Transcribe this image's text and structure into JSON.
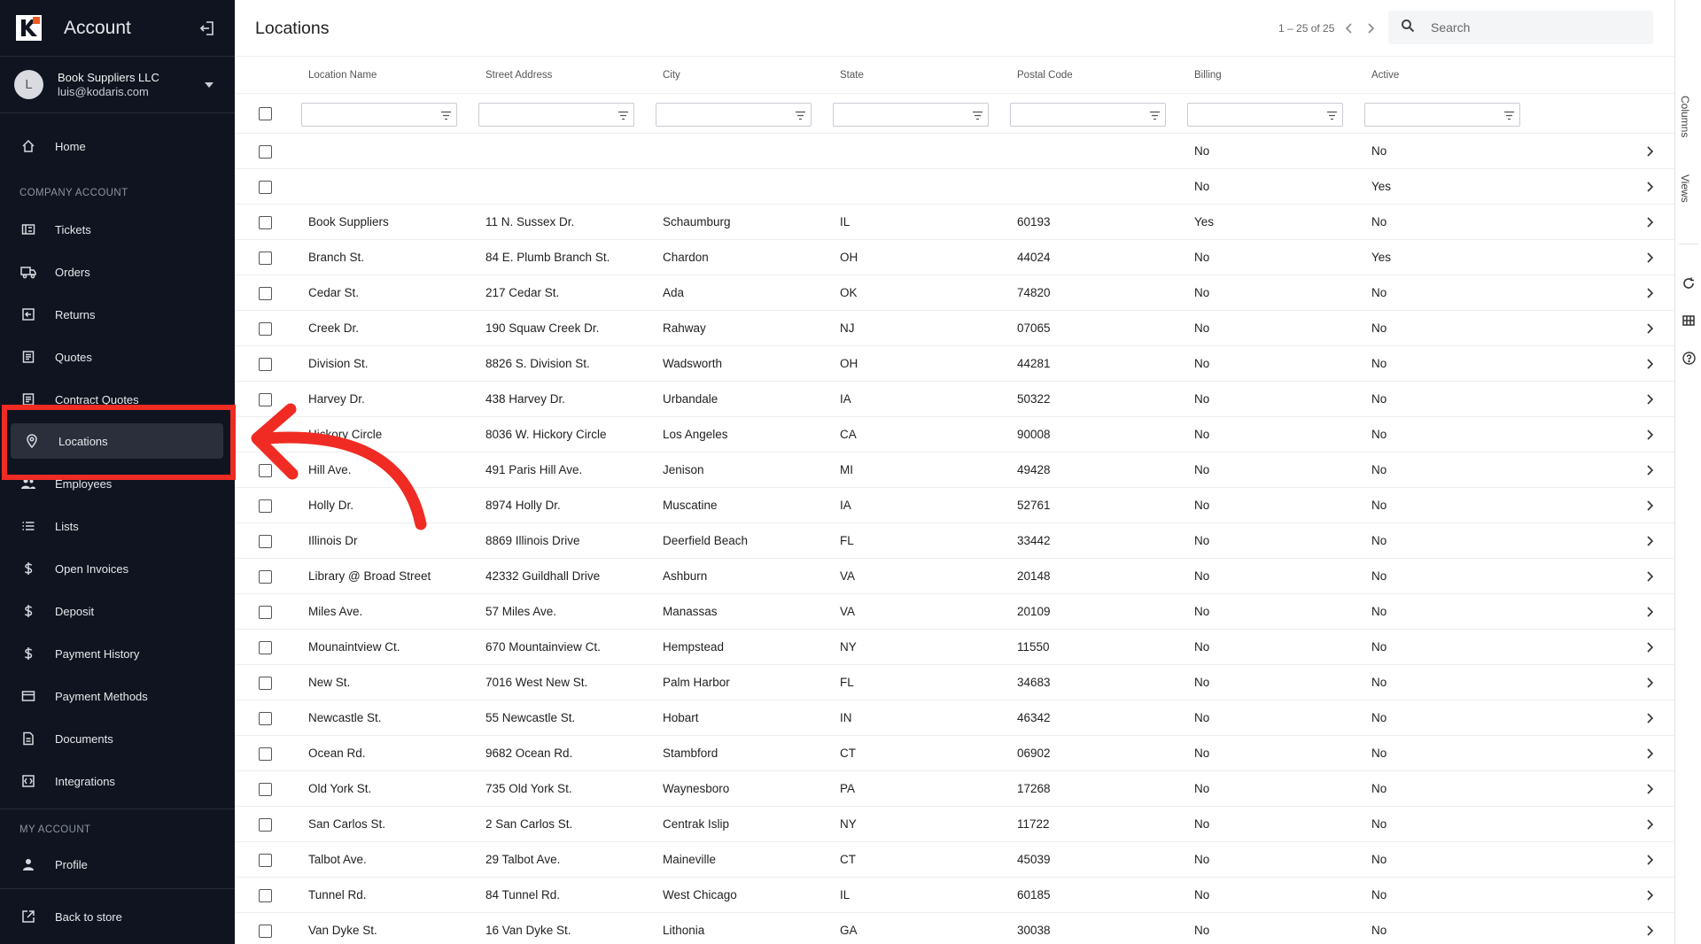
{
  "sidebar": {
    "title": "Account",
    "account": {
      "avatar_letter": "L",
      "company": "Book Suppliers LLC",
      "email": "luis@kodaris.com"
    },
    "home_label": "Home",
    "company_section": "COMPANY ACCOUNT",
    "company_items": [
      {
        "label": "Tickets",
        "icon": "ticket-icon"
      },
      {
        "label": "Orders",
        "icon": "truck-icon"
      },
      {
        "label": "Returns",
        "icon": "return-icon"
      },
      {
        "label": "Quotes",
        "icon": "document-icon"
      },
      {
        "label": "Contract Quotes",
        "icon": "document-icon"
      },
      {
        "label": "Locations",
        "icon": "location-pin-icon",
        "active": true
      },
      {
        "label": "Employees",
        "icon": "people-icon"
      },
      {
        "label": "Lists",
        "icon": "list-icon"
      },
      {
        "label": "Open Invoices",
        "icon": "dollar-icon"
      },
      {
        "label": "Deposit",
        "icon": "dollar-icon"
      },
      {
        "label": "Payment History",
        "icon": "dollar-icon"
      },
      {
        "label": "Payment Methods",
        "icon": "credit-card-icon"
      },
      {
        "label": "Documents",
        "icon": "file-icon"
      },
      {
        "label": "Integrations",
        "icon": "integration-icon"
      }
    ],
    "my_section": "MY ACCOUNT",
    "profile_label": "Profile",
    "back_label": "Back to store"
  },
  "main": {
    "title": "Locations",
    "pagination": "1 – 25 of 25",
    "search_placeholder": "Search",
    "columns": [
      "Location Name",
      "Street Address",
      "City",
      "State",
      "Postal Code",
      "Billing",
      "Active"
    ],
    "rows": [
      [
        "",
        "",
        "",
        "",
        "",
        "No",
        "No"
      ],
      [
        "",
        "",
        "",
        "",
        "",
        "No",
        "Yes"
      ],
      [
        "Book Suppliers",
        "11 N. Sussex Dr.",
        "Schaumburg",
        "IL",
        "60193",
        "Yes",
        "No"
      ],
      [
        "Branch St.",
        "84 E. Plumb Branch St.",
        "Chardon",
        "OH",
        "44024",
        "No",
        "Yes"
      ],
      [
        "Cedar St.",
        "217 Cedar St.",
        "Ada",
        "OK",
        "74820",
        "No",
        "No"
      ],
      [
        "Creek Dr.",
        "190 Squaw Creek Dr.",
        "Rahway",
        "NJ",
        "07065",
        "No",
        "No"
      ],
      [
        "Division St.",
        "8826 S. Division St.",
        "Wadsworth",
        "OH",
        "44281",
        "No",
        "No"
      ],
      [
        "Harvey Dr.",
        "438 Harvey Dr.",
        "Urbandale",
        "IA",
        "50322",
        "No",
        "No"
      ],
      [
        "Hickory Circle",
        "8036 W. Hickory Circle",
        "Los Angeles",
        "CA",
        "90008",
        "No",
        "No"
      ],
      [
        "Hill Ave.",
        "491 Paris Hill Ave.",
        "Jenison",
        "MI",
        "49428",
        "No",
        "No"
      ],
      [
        "Holly Dr.",
        "8974 Holly Dr.",
        "Muscatine",
        "IA",
        "52761",
        "No",
        "No"
      ],
      [
        "Illinois Dr",
        "8869 Illinois Drive",
        "Deerfield Beach",
        "FL",
        "33442",
        "No",
        "No"
      ],
      [
        "Library @ Broad Street",
        "42332 Guildhall Drive",
        "Ashburn",
        "VA",
        "20148",
        "No",
        "No"
      ],
      [
        "Miles Ave.",
        "57 Miles Ave.",
        "Manassas",
        "VA",
        "20109",
        "No",
        "No"
      ],
      [
        "Mounaintview Ct.",
        "670 Mountainview Ct.",
        "Hempstead",
        "NY",
        "11550",
        "No",
        "No"
      ],
      [
        "New St.",
        "7016 West New St.",
        "Palm Harbor",
        "FL",
        "34683",
        "No",
        "No"
      ],
      [
        "Newcastle St.",
        "55 Newcastle St.",
        "Hobart",
        "IN",
        "46342",
        "No",
        "No"
      ],
      [
        "Ocean Rd.",
        "9682 Ocean Rd.",
        "Stambford",
        "CT",
        "06902",
        "No",
        "No"
      ],
      [
        "Old York St.",
        "735 Old York St.",
        "Waynesboro",
        "PA",
        "17268",
        "No",
        "No"
      ],
      [
        "San Carlos St.",
        "2 San Carlos St.",
        "Centrak Islip",
        "NY",
        "11722",
        "No",
        "No"
      ],
      [
        "Talbot Ave.",
        "29 Talbot Ave.",
        "Maineville",
        "CT",
        "45039",
        "No",
        "No"
      ],
      [
        "Tunnel Rd.",
        "84 Tunnel Rd.",
        "West Chicago",
        "IL",
        "60185",
        "No",
        "No"
      ],
      [
        "Van Dyke St.",
        "16 Van Dyke St.",
        "Lithonia",
        "GA",
        "30038",
        "No",
        "No"
      ]
    ]
  },
  "rightbar": {
    "columns_label": "Columns",
    "views_label": "Views"
  },
  "colors": {
    "sidebar_bg": "#0f1420",
    "active_item_bg": "#2a2f3b",
    "annotation_red": "#ef2b24"
  }
}
